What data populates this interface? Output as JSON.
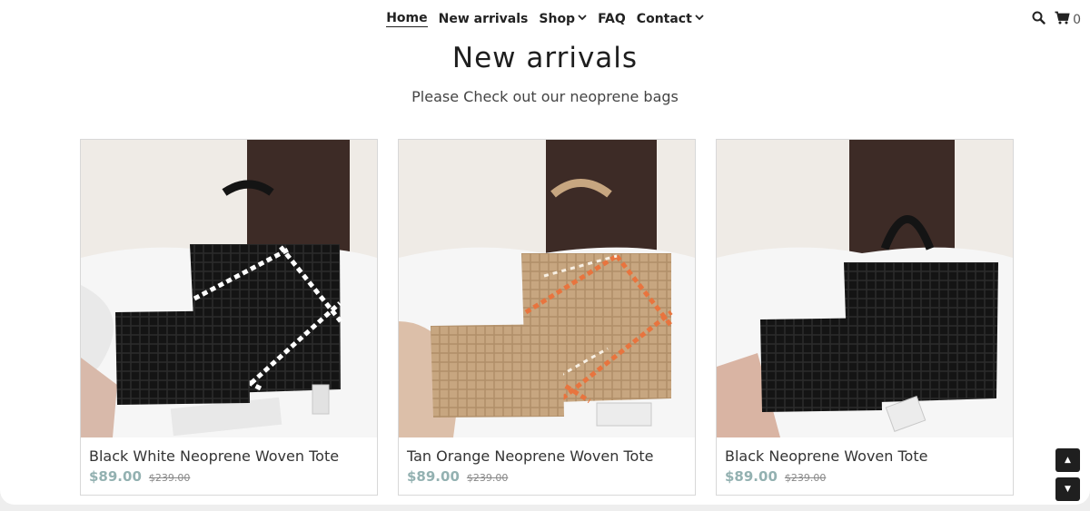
{
  "nav": {
    "items": [
      {
        "label": "Home"
      },
      {
        "label": "New arrivals"
      },
      {
        "label": "Shop"
      },
      {
        "label": "FAQ"
      },
      {
        "label": "Contact"
      }
    ]
  },
  "header_tools": {
    "search_icon": "search-icon",
    "cart_icon": "cart-icon",
    "cart_count": "0"
  },
  "main": {
    "title": "New arrivals",
    "subtitle": "Please Check out our neoprene bags"
  },
  "products": [
    {
      "name": "Black White Neoprene Woven Tote",
      "price": "$89.00",
      "compare_price": "$239.00"
    },
    {
      "name": "Tan Orange Neoprene Woven Tote",
      "price": "$89.00",
      "compare_price": "$239.00"
    },
    {
      "name": "Black Neoprene Woven Tote",
      "price": "$89.00",
      "compare_price": "$239.00"
    }
  ],
  "colors": {
    "price": "#93b1b1",
    "text": "#222222",
    "bag_black": "#141414",
    "bag_tan": "#c7a680",
    "stripe_orange": "#e8743e"
  },
  "scroll_controls": {
    "up_icon": "arrow-up-icon",
    "down_icon": "arrow-down-icon"
  }
}
